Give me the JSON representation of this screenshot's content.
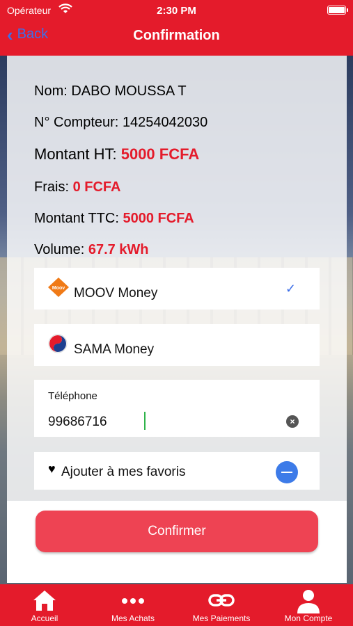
{
  "status_bar": {
    "carrier": "Opérateur",
    "time": "2:30 PM"
  },
  "nav": {
    "back_label": "Back",
    "title": "Confirmation"
  },
  "details": {
    "nom_label": "Nom: ",
    "nom_value": "DABO MOUSSA T",
    "compteur_label": "N° Compteur: ",
    "compteur_value": "14254042030",
    "montant_ht_label": "Montant HT: ",
    "montant_ht_value": "5000 FCFA",
    "frais_label": "Frais: ",
    "frais_value": "0 FCFA",
    "montant_ttc_label": "Montant TTC: ",
    "montant_ttc_value": "5000 FCFA",
    "volume_label": "Volume: ",
    "volume_value": "67.7 kWh"
  },
  "payment_options": [
    {
      "label": "MOOV Money",
      "selected": true,
      "logo_text": "Moov"
    },
    {
      "label": "SAMA Money",
      "selected": false
    }
  ],
  "phone": {
    "label": "Téléphone",
    "value": "99686716"
  },
  "favorite": {
    "label": "Ajouter à mes favoris"
  },
  "confirm_button": {
    "label": "Confirmer"
  },
  "tabbar": {
    "tabs": [
      {
        "label": "Accueil",
        "icon": "home-icon"
      },
      {
        "label": "Mes Achats",
        "icon": "more-dots-icon"
      },
      {
        "label": "Mes Paiements",
        "icon": "link-icon"
      },
      {
        "label": "Mon Compte",
        "icon": "user-icon"
      }
    ]
  },
  "colors": {
    "brand_red": "#e41b2b",
    "accent_blue": "#3d6fe8",
    "button_red": "#ee4353"
  }
}
